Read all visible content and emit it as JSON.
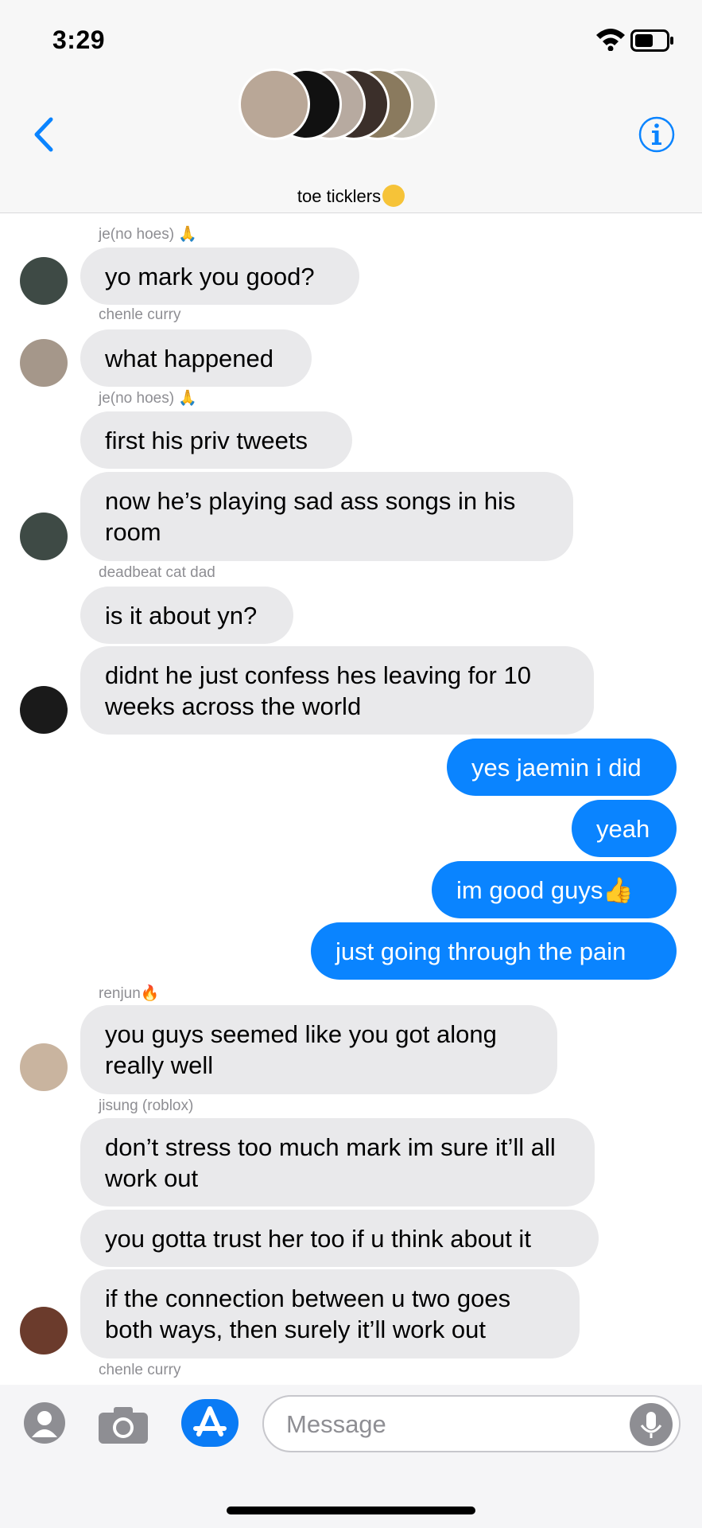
{
  "status": {
    "time": "3:29"
  },
  "header": {
    "group_name": "toe ticklers"
  },
  "messages": [
    {
      "sender": "je(no hoes)",
      "text": "yo mark you good?"
    },
    {
      "sender": "chenle curry",
      "text": "what happened"
    },
    {
      "sender": "je(no hoes)",
      "text": "first his priv tweets"
    },
    {
      "text": "now he’s playing sad ass songs in his room"
    },
    {
      "sender": "deadbeat cat dad",
      "text": "is it about yn?"
    },
    {
      "text": "didnt he just confess hes leaving for 10 weeks across the world"
    },
    {
      "text": "yes jaemin i did"
    },
    {
      "text": "yeah"
    },
    {
      "text": "im good guys"
    },
    {
      "text": "just going through the pain"
    },
    {
      "sender": "renjun",
      "text": "you guys seemed like you got along really well"
    },
    {
      "sender": "jisung (roblox)",
      "text": "don’t stress too much mark im sure it’ll all work out"
    },
    {
      "text": "you gotta trust her too if u think about it"
    },
    {
      "text": "if the connection between u two goes both ways, then surely it’ll work out"
    },
    {
      "sender": "chenle curry"
    }
  ],
  "input": {
    "placeholder": "Message"
  },
  "colors": {
    "outgoing": "#0a84ff",
    "incoming": "#e9e9eb",
    "accent": "#0a84ff"
  },
  "icons": [
    "back-chevron-icon",
    "info-icon",
    "wifi-icon",
    "battery-icon",
    "apps-icon",
    "camera-icon",
    "appstore-icon",
    "microphone-icon"
  ]
}
